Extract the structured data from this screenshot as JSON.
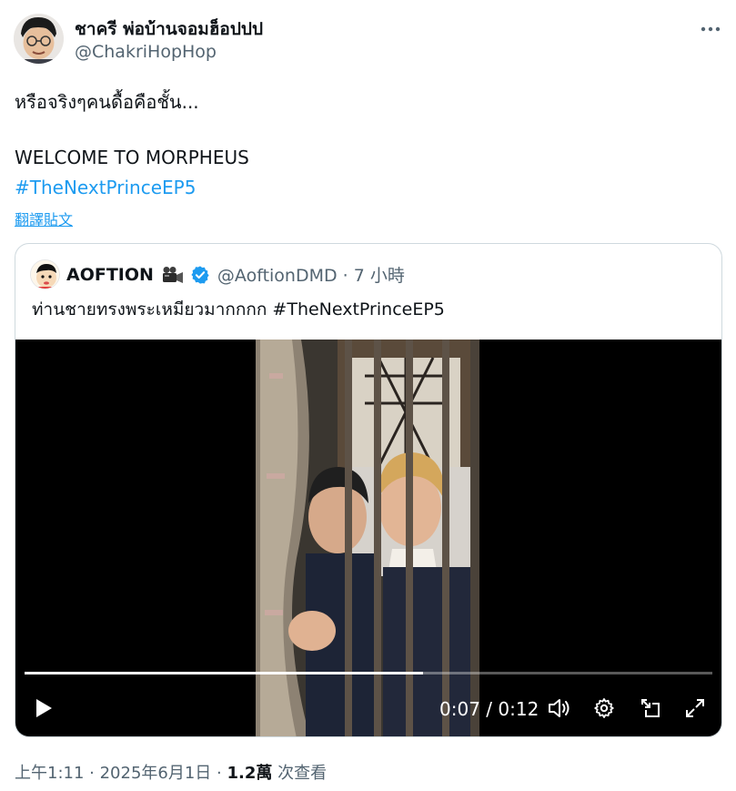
{
  "author": {
    "name": "ชาครี พ่อบ้านจอมฮ็อปปป",
    "handle": "@ChakriHopHop",
    "avatar_icon": "avatar-photo"
  },
  "tweet": {
    "line1": "หรือจริงๆคนดื้อคือชั้น...",
    "line2": "WELCOME TO MORPHEUS",
    "hashtag": "#TheNextPrinceEP5",
    "translate_label": "翻譯貼文"
  },
  "quote": {
    "name": "AOFTION",
    "emoji_icon": "video-camera-icon",
    "handle_time": "@AoftionDMD · 7 小時",
    "text": "ท่านชายทรงพระเหมียวมากกกก #TheNextPrinceEP5",
    "video": {
      "current_time": "0:07",
      "separator": "/",
      "duration": "0:12",
      "progress_fraction": 0.58
    }
  },
  "meta": {
    "time_date": "上午1:11 · 2025年6月1日 · ",
    "views": "1.2萬",
    "views_label": " 次查看"
  },
  "colors": {
    "accent": "#1d9bf0",
    "secondary_text": "#536471",
    "border": "#cfd9de"
  }
}
